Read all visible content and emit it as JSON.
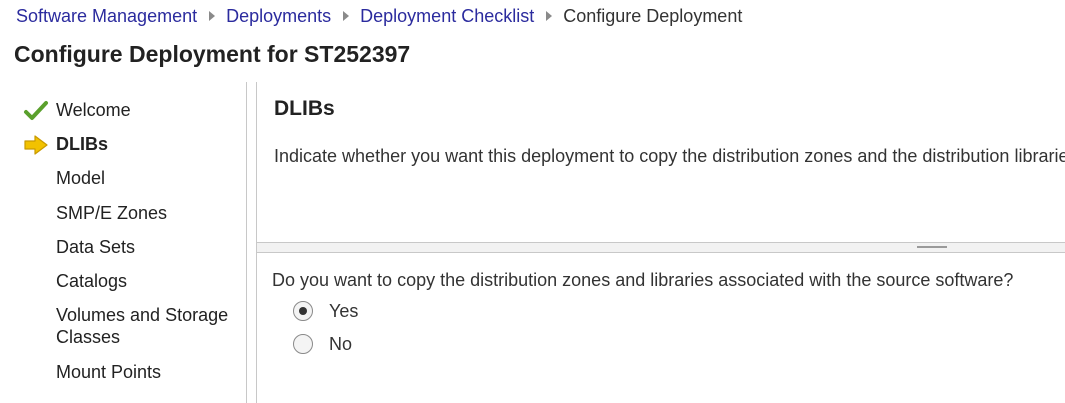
{
  "breadcrumb": {
    "items": [
      "Software Management",
      "Deployments",
      "Deployment Checklist"
    ],
    "current": "Configure Deployment"
  },
  "page": {
    "title": "Configure Deployment for ST252397"
  },
  "sidebar": {
    "steps": [
      {
        "label": "Welcome",
        "status": "complete",
        "icon": "checkmark-icon"
      },
      {
        "label": "DLIBs",
        "status": "current",
        "icon": "arrow-right-icon"
      },
      {
        "label": "Model"
      },
      {
        "label": "SMP/E Zones"
      },
      {
        "label": "Data Sets"
      },
      {
        "label": "Catalogs"
      },
      {
        "label": "Volumes and Storage Classes",
        "line1": "Volumes and Storage",
        "line2": "Classes"
      },
      {
        "label": "Mount Points"
      }
    ]
  },
  "main": {
    "section_title": "DLIBs",
    "description": "Indicate whether you want this deployment to copy the distribution zones and the distribution libraries",
    "question": "Do you want to copy the distribution zones and libraries associated with the source software?",
    "options": [
      {
        "label": "Yes",
        "selected": true
      },
      {
        "label": "No",
        "selected": false
      }
    ]
  },
  "colors": {
    "link": "#2b2b9e",
    "check_green": "#5aa02c",
    "arrow_yellow": "#f2c200"
  }
}
